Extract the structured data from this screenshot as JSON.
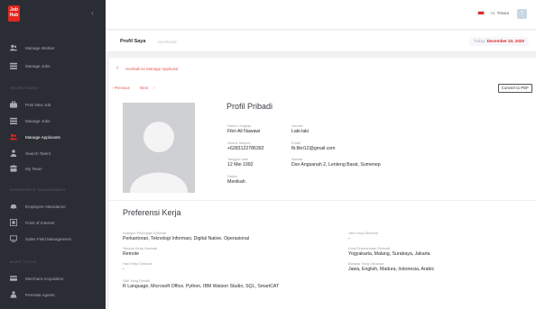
{
  "brand": {
    "logo_text": "Job\nHub",
    "accent": "#e52520"
  },
  "sidebar": {
    "items": [
      {
        "label": "Manage Worker",
        "icon": "users-icon"
      },
      {
        "label": "Manage Jobs",
        "icon": "list-icon"
      },
      {
        "label": "Post New Job",
        "icon": "briefcase-icon"
      },
      {
        "label": "Manage Jobs",
        "icon": "list-icon"
      },
      {
        "label": "Manage Applicants",
        "icon": "users-icon"
      },
      {
        "label": "Search Talent",
        "icon": "person-search-icon"
      },
      {
        "label": "My Team",
        "icon": "team-icon"
      },
      {
        "label": "Employee Attendance",
        "icon": "car-icon"
      },
      {
        "label": "Point of Interest",
        "icon": "map-pin-icon"
      },
      {
        "label": "Sales Field Management",
        "icon": "monitor-icon"
      },
      {
        "label": "Merchant Acquisition",
        "icon": "card-icon"
      },
      {
        "label": "Permata Agents",
        "icon": "agent-icon"
      }
    ],
    "sections": [
      "RECRUITMENT",
      "WORKFORCE MANAGEMENT",
      "MORE TOOLS"
    ]
  },
  "header": {
    "greeting": "Hi, ",
    "user_name": "Triana",
    "avatar_initial": "T"
  },
  "subheader": {
    "title": "Profil Saya",
    "crumb": "Dashboard",
    "date_label": "Today: ",
    "date_value": "December 23, 2020"
  },
  "profile": {
    "back_label": "Kembali ke Manage Applicant",
    "previous_label": "Previous",
    "next_label": "Next",
    "convert_label": "Convert to PDF",
    "section_title": "Profil Pribadi",
    "fields": {
      "nama_label": "Nama Lengkap",
      "nama_value": "Fikri Ali Nawawi",
      "gender_label": "Gender",
      "gender_value": "Laki-laki",
      "telp_label": "Nomor telepon",
      "telp_value": "+6283122786392",
      "email_label": "Email",
      "email_value": "fb.fikri12@gmail.com",
      "lahir_label": "Tanggal Lahir",
      "lahir_value": "12 Mei 1992",
      "alamat_label": "Alamat",
      "alamat_value": "Dsn Angsanah 2, Lenteng Barat, Sumenep",
      "status_label": "Status",
      "status_value": "Menikah"
    }
  },
  "preferensi": {
    "section_title": "Preferensi Kerja",
    "kategori_label": "Kategori Pekerjaan Diminati",
    "kategori_value": "Perkantoran, Teknologi Informasi, Digital Native, Operasional",
    "tempat_label": "Tempat Kerja Diminati",
    "tempat_value": "Remote",
    "hari_label": "Hari Kerja Diminati",
    "hari_value": "-",
    "skill_label": "Skill Yang Dimiliki",
    "skill_value": "R Language, Microsoft Office, Python, IBM Watson Studio, SQL, SmartCAT",
    "jam_label": "Jam Kerja Diminati",
    "jam_value": "-",
    "kota_label": "Kota Penempatan Diminati",
    "kota_value": "Yogyakarta, Malang, Surabaya, Jakarta",
    "bahasa_label": "Bahasa Yang Dikuasai",
    "bahasa_value": "Jawa, English, Madura, Indonesia, Arabic"
  }
}
